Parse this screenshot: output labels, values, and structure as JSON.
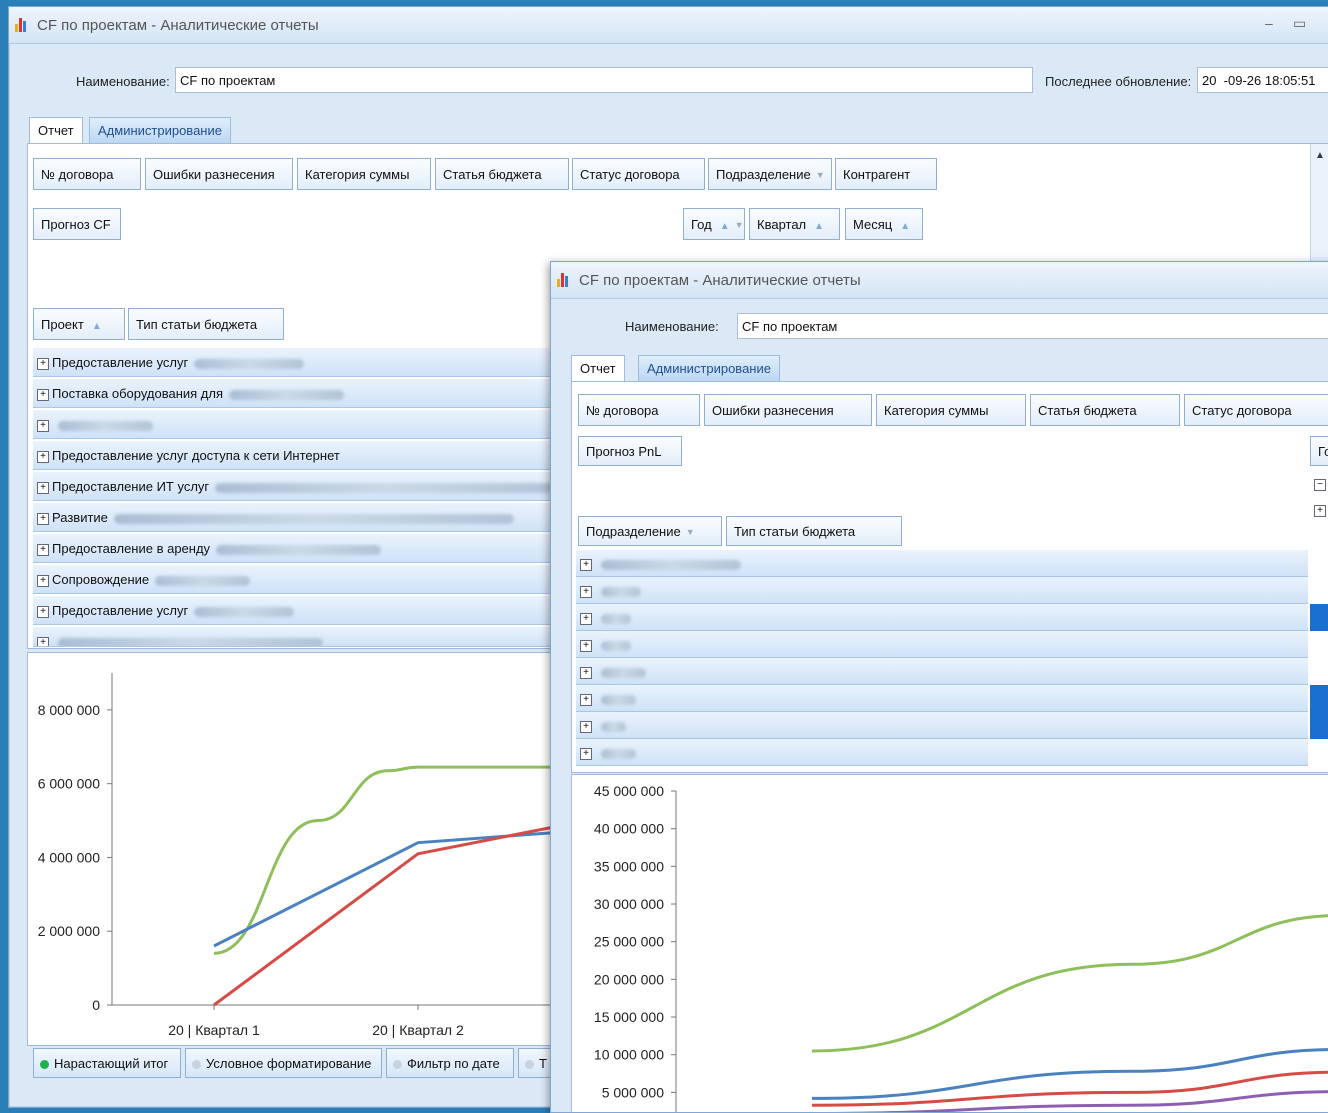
{
  "colors": {
    "accent": "#1a6fd1",
    "series_green": "#8dbf5a",
    "series_blue": "#4a82c0",
    "series_red": "#d64b45",
    "series_purple": "#8c5fb3"
  },
  "window1": {
    "title": "CF по проектам - Аналитические отчеты",
    "name_label": "Наименование:",
    "name_value": "CF по проектам",
    "updated_label": "Последнее обновление:",
    "updated_value": "20  -09-26 18:05:51",
    "tabs": [
      "Отчет",
      "Администрирование"
    ],
    "filter_fields": [
      "№ договора",
      "Ошибки разнесения",
      "Категория суммы",
      "Статья бюджета",
      "Статус договора",
      "Подразделение",
      "Контрагент"
    ],
    "data_field": "Прогноз CF",
    "column_fields": [
      "Год",
      "Квартал",
      "Месяц"
    ],
    "row_fields": [
      "Проект",
      "Тип статьи бюджета"
    ],
    "rows": [
      "Предоставление услуг",
      "Поставка оборудования для",
      "",
      "Предоставление услуг доступа к сети Интернет",
      "Предоставление ИТ услуг",
      "Развитие",
      "Предоставление в аренду",
      "Сопровождение",
      "Предоставление услуг",
      ""
    ],
    "options": [
      "Нарастающий итог",
      "Условное форматирование",
      "Фильтр по дате",
      "Т"
    ]
  },
  "window2": {
    "title": "CF по проектам - Аналитические отчеты",
    "name_label": "Наименование:",
    "name_value": "CF по проектам",
    "tabs": [
      "Отчет",
      "Администрирование"
    ],
    "filter_fields": [
      "№ договора",
      "Ошибки разнесения",
      "Категория суммы",
      "Статья бюджета",
      "Статус договора"
    ],
    "data_field": "Прогноз PnL",
    "column_field_partial": "Го",
    "row_fields": [
      "Подразделение",
      "Тип статьи бюджета"
    ],
    "rows": [
      "",
      "",
      "",
      "",
      "",
      "",
      "",
      ""
    ]
  },
  "chart_data": [
    {
      "type": "line",
      "title": "",
      "xlabel": "",
      "ylabel": "",
      "categories": [
        "20  | Квартал 1",
        "20  | Квартал 2"
      ],
      "y_ticks": [
        "0",
        "2 000 000",
        "4 000 000",
        "6 000 000",
        "8 000 000"
      ],
      "ylim": [
        0,
        9000000
      ],
      "series": [
        {
          "color": "#8dbf5a",
          "values": [
            1400000,
            6450000
          ]
        },
        {
          "color": "#4a82c0",
          "values": [
            1600000,
            4400000
          ]
        },
        {
          "color": "#d64b45",
          "values": [
            0,
            4100000
          ]
        }
      ]
    },
    {
      "type": "line",
      "title": "",
      "xlabel": "",
      "ylabel": "",
      "y_ticks": [
        "5 000 000",
        "10 000 000",
        "15 000 000",
        "20 000 000",
        "25 000 000",
        "30 000 000",
        "35 000 000",
        "40 000 000",
        "45 000 000"
      ],
      "ylim": [
        2000000,
        45000000
      ],
      "series": [
        {
          "color": "#8dbf5a",
          "values": [
            10500000,
            22000000,
            28500000
          ]
        },
        {
          "color": "#4a82c0",
          "values": [
            4200000,
            7800000,
            10700000
          ]
        },
        {
          "color": "#d64b45",
          "values": [
            3300000,
            5000000,
            7700000
          ]
        },
        {
          "color": "#8c5fb3",
          "values": [
            2200000,
            3300000,
            5100000
          ]
        }
      ]
    }
  ]
}
